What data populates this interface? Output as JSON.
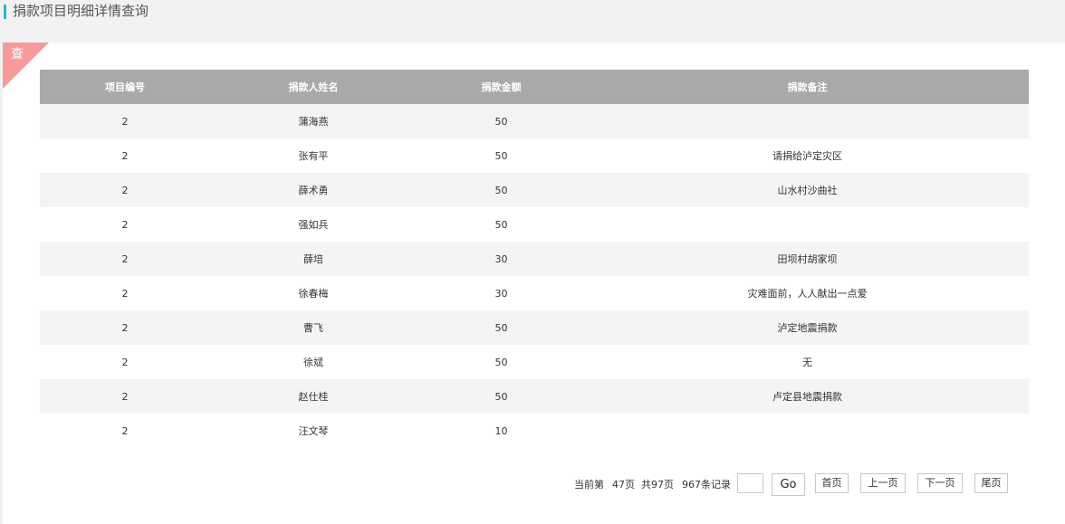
{
  "header": {
    "title": "捐款项目明细详情查询"
  },
  "panel": {
    "corner_label": "查"
  },
  "table": {
    "columns": [
      "项目编号",
      "捐款人姓名",
      "捐款金额",
      "捐款备注"
    ],
    "rows": [
      [
        "2",
        "蒲海燕",
        "50",
        ""
      ],
      [
        "2",
        "张有平",
        "50",
        "请捐给泸定灾区"
      ],
      [
        "2",
        "薛术勇",
        "50",
        "山水村沙曲社"
      ],
      [
        "2",
        "强如兵",
        "50",
        ""
      ],
      [
        "2",
        "薛培",
        "30",
        "田坝村胡家坝"
      ],
      [
        "2",
        "徐春梅",
        "30",
        "灾难面前，人人献出一点爱"
      ],
      [
        "2",
        "曹飞",
        "50",
        "泸定地震捐款"
      ],
      [
        "2",
        "徐斌",
        "50",
        "无"
      ],
      [
        "2",
        "赵仕桂",
        "50",
        "卢定县地震捐款"
      ],
      [
        "2",
        "汪文琴",
        "10",
        ""
      ]
    ]
  },
  "pager": {
    "current_label": "当前第",
    "current_page": "47页",
    "total_pages": "共97页",
    "total_records": "967条记录",
    "go_label": "Go",
    "first_label": "首页",
    "prev_label": "上一页",
    "next_label": "下一页",
    "last_label": "尾页"
  },
  "colors": {
    "accent": "#29b6d8",
    "corner": "#f79a9a",
    "table_header": "#a9a9a9",
    "row_stripe": "#f4f4f4"
  }
}
